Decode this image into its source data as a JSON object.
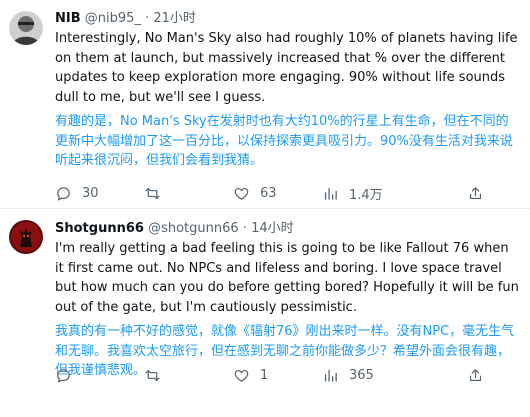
{
  "tweets": [
    {
      "name": "NIB",
      "handle": "@nib95_",
      "separator": "·",
      "time": "21小时",
      "text": "Interestingly, No Man's Sky also had roughly 10% of planets having life on them at launch, but massively increased that % over the different updates to keep exploration more engaging. 90% without life sounds dull to me, but we'll see I guess.",
      "translation": "有趣的是，No Man's Sky在发射时也有大约10%的行星上有生命，但在不同的更新中大幅增加了这一百分比，以保持探索更具吸引力。90%没有生活对我来说听起来很沉闷，但我们会看到我猜。",
      "replies": "30",
      "retweets": "",
      "likes": "63",
      "views": "1.4万"
    },
    {
      "name": "Shotgunn66",
      "handle": "@shotgunn66",
      "separator": "·",
      "time": "14小时",
      "text": "I'm really getting a bad feeling this is going to be like Fallout 76 when it first came out. No NPCs and lifeless and boring. I love space travel but how much can you do before getting bored? Hopefully it will be fun out of the gate, but I'm cautiously pessimistic.",
      "translation": "我真的有一种不好的感觉，就像《辐射76》刚出来时一样。没有NPC，毫无生气和无聊。我喜欢太空旅行，但在感到无聊之前你能做多少？希望外面会很有趣，但我谨慎悲观。",
      "replies": "",
      "retweets": "",
      "likes": "1",
      "views": "365"
    }
  ],
  "icons": {
    "reply": "reply-icon",
    "retweet": "retweet-icon",
    "like": "heart-icon",
    "views": "views-icon",
    "share": "share-icon"
  },
  "colors": {
    "translation": "#1d9bf0",
    "muted": "#536471",
    "divider": "#e6ecf0"
  }
}
